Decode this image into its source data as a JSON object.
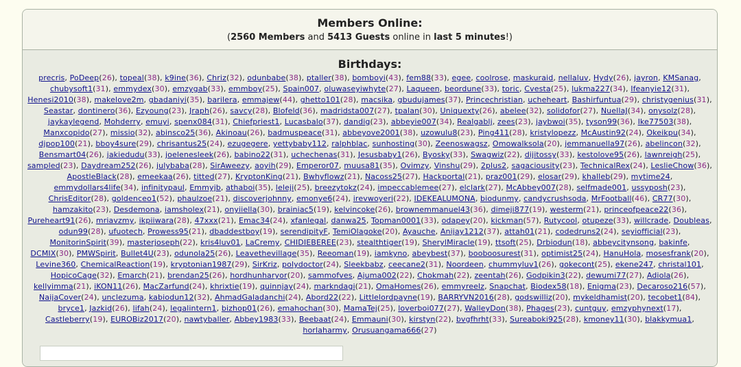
{
  "online": {
    "title": "Members Online:",
    "members_count": "2560 Members",
    "and_word": "and",
    "guests_count": "5413 Guests",
    "online_in": "online in",
    "period": "last 5 minutes",
    "open_paren": "(",
    "close": "!)"
  },
  "birthdays": {
    "title": "Birthdays:",
    "members": [
      [
        "precris",
        null
      ],
      [
        "PoDeep",
        "26"
      ],
      [
        "topeal",
        "38"
      ],
      [
        "k9ine",
        "36"
      ],
      [
        "Chriz",
        "32"
      ],
      [
        "odunbabe",
        "38"
      ],
      [
        "ptaller",
        "38"
      ],
      [
        "bomboyi",
        "43"
      ],
      [
        "fem88",
        "33"
      ],
      [
        "egee",
        null
      ],
      [
        "coolrose",
        null
      ],
      [
        "maskuraid",
        null
      ],
      [
        "nellaluv",
        null
      ],
      [
        "Hydy",
        "26"
      ],
      [
        "jayron",
        null
      ],
      [
        "KMSanag",
        null
      ],
      [
        "chubysoft1",
        "31"
      ],
      [
        "emmydex",
        "30"
      ],
      [
        "emzygab",
        "33"
      ],
      [
        "emmboy",
        "25"
      ],
      [
        "Spain007",
        null
      ],
      [
        "oluwaseyiwhyte",
        "27"
      ],
      [
        "Laqueen",
        null
      ],
      [
        "beordune",
        "33"
      ],
      [
        "toric",
        null
      ],
      [
        "Cvesta",
        "25"
      ],
      [
        "lukma227",
        "34"
      ],
      [
        "Ifeanyie12",
        "31"
      ],
      [
        "Henesi2010",
        "38"
      ],
      [
        "makelove2m",
        null
      ],
      [
        "gbadaniyi",
        "35"
      ],
      [
        "barilera",
        null
      ],
      [
        "emmajew",
        "44"
      ],
      [
        "ghetto101",
        "28"
      ],
      [
        "macsika",
        null
      ],
      [
        "gbudujames",
        "37"
      ],
      [
        "Princechristian",
        null
      ],
      [
        "ucheheart",
        null
      ],
      [
        "Bashirfuntua",
        "29"
      ],
      [
        "christygenius",
        "31"
      ],
      [
        "Seastar",
        null
      ],
      [
        "dontinero",
        "36"
      ],
      [
        "Ezyoung",
        "23"
      ],
      [
        "Jraph",
        "26"
      ],
      [
        "savcy",
        "28"
      ],
      [
        "Blofeld",
        "36"
      ],
      [
        "madridsta007",
        "27"
      ],
      [
        "tpalan",
        "30"
      ],
      [
        "Uniquexty",
        "26"
      ],
      [
        "abelee",
        "32"
      ],
      [
        "solidofor",
        "27"
      ],
      [
        "NuellaJ",
        "34"
      ],
      [
        "onysolz",
        "28"
      ],
      [
        "jaykaylegend",
        null
      ],
      [
        "Mohderry",
        null
      ],
      [
        "emuyi",
        null
      ],
      [
        "spenx084",
        "31"
      ],
      [
        "Chiefpriest1",
        null
      ],
      [
        "Lucasbalo",
        "37"
      ],
      [
        "dandig",
        "23"
      ],
      [
        "abbeyie007",
        "34"
      ],
      [
        "Realgablj",
        null
      ],
      [
        "zees",
        "23"
      ],
      [
        "jaybwoi",
        "35"
      ],
      [
        "tyson99",
        "36"
      ],
      [
        "Ike77503",
        "38"
      ],
      [
        "Manxcopido",
        "27"
      ],
      [
        "missio",
        "32"
      ],
      [
        "abinsco25",
        "36"
      ],
      [
        "Akinoau",
        "26"
      ],
      [
        "badmuspeace",
        "31"
      ],
      [
        "abbeyove2001",
        "38"
      ],
      [
        "uzowulu8",
        "23"
      ],
      [
        "Ping411",
        "28"
      ],
      [
        "kristylopezz",
        null
      ],
      [
        "McAustin92",
        "24"
      ],
      [
        "Okeikpu",
        "34"
      ],
      [
        "djpop100",
        "21"
      ],
      [
        "bboy4sure",
        "29"
      ],
      [
        "chrisantus25",
        "24"
      ],
      [
        "ezugegere",
        null
      ],
      [
        "yettybaby112",
        null
      ],
      [
        "ralphblac",
        null
      ],
      [
        "sunhosting",
        "30"
      ],
      [
        "Zeenoswagsz",
        null
      ],
      [
        "Omowalksola",
        "20"
      ],
      [
        "jemmanuella97",
        "26"
      ],
      [
        "abelincon",
        "32"
      ],
      [
        "Bensmart04",
        "26"
      ],
      [
        "jakiedudu",
        "33"
      ],
      [
        "joelenesleek",
        "26"
      ],
      [
        "babino22",
        "31"
      ],
      [
        "uchechenas",
        "31"
      ],
      [
        "Jesusbaby1",
        "26"
      ],
      [
        "Byosky",
        "33"
      ],
      [
        "Swagwiz",
        "22"
      ],
      [
        "dijitossy",
        "33"
      ],
      [
        "kestolove95",
        "26"
      ],
      [
        "lawnreigh",
        "25"
      ],
      [
        "sampled",
        "23"
      ],
      [
        "Daydream252",
        "26"
      ],
      [
        "julybaba",
        "28"
      ],
      [
        "SirAweezy",
        null
      ],
      [
        "aoyih",
        "29"
      ],
      [
        "Emperor07",
        null
      ],
      [
        "muusa81",
        "35"
      ],
      [
        "Ovimzy",
        null
      ],
      [
        "Vinshu",
        "29"
      ],
      [
        "2plus2",
        null
      ],
      [
        "sagaciousity",
        "23"
      ],
      [
        "TechnicalRex",
        "24"
      ],
      [
        "LeslieChow",
        "36"
      ],
      [
        "ApostleBlack",
        "28"
      ],
      [
        "emeekaa",
        "26"
      ],
      [
        "titted",
        "27"
      ],
      [
        "KryptonKing",
        "21"
      ],
      [
        "Bwhyflowz",
        "21"
      ],
      [
        "Nacoss25",
        "27"
      ],
      [
        "Hackportal",
        "21"
      ],
      [
        "praz001",
        "29"
      ],
      [
        "elosar",
        "29"
      ],
      [
        "khalleb",
        "29"
      ],
      [
        "mytime24",
        null
      ],
      [
        "emmydollars4life",
        "34"
      ],
      [
        "infinitypaul",
        null
      ],
      [
        "Emmyjb",
        null
      ],
      [
        "athaboi",
        "35"
      ],
      [
        "leleji",
        "25"
      ],
      [
        "breezytokz",
        "24"
      ],
      [
        "impeccablemee",
        "27"
      ],
      [
        "elclark",
        "27"
      ],
      [
        "McAbbey007",
        "28"
      ],
      [
        "selfmade001",
        null
      ],
      [
        "ussyposh",
        "23"
      ],
      [
        "ChrisEditor",
        "28"
      ],
      [
        "goldenceo1",
        "52"
      ],
      [
        "phaulzoe",
        "21"
      ],
      [
        "discoverjohnny",
        null
      ],
      [
        "emonye6",
        "24"
      ],
      [
        "irevwoyeri",
        "22"
      ],
      [
        "IDEKEALUMONA",
        null
      ],
      [
        "biodunmy",
        null
      ],
      [
        "candycrushsoda",
        null
      ],
      [
        "MrFootball",
        "46"
      ],
      [
        "CR77",
        "30"
      ],
      [
        "hamzakito",
        "23"
      ],
      [
        "Desdemona",
        null
      ],
      [
        "iamsholex",
        "21"
      ],
      [
        "onyiiella",
        "30"
      ],
      [
        "brainiac5",
        "19"
      ],
      [
        "kelvincoke",
        "26"
      ],
      [
        "brownemmanuel43",
        "36"
      ],
      [
        "dimeji877",
        "19"
      ],
      [
        "westerm",
        "21"
      ],
      [
        "princeofpeace22",
        "36"
      ],
      [
        "Pureheart91",
        "26"
      ],
      [
        "mriavzmy",
        null
      ],
      [
        "ikpiiwara",
        "28"
      ],
      [
        "47xxx",
        "21"
      ],
      [
        "Emac34",
        "24"
      ],
      [
        "xfanlegal",
        null
      ],
      [
        "danwa25",
        null
      ],
      [
        "Topman0001",
        "33"
      ],
      [
        "odapey",
        "20"
      ],
      [
        "kickman",
        "57"
      ],
      [
        "Rutycool",
        null
      ],
      [
        "otupeze",
        "33"
      ],
      [
        "willcrade",
        null
      ],
      [
        "Doubleas",
        null
      ],
      [
        "odun99",
        "28"
      ],
      [
        "ufuotech",
        null
      ],
      [
        "Prowess95",
        "21"
      ],
      [
        "dbaddestboy",
        "19"
      ],
      [
        "serendipityF",
        null
      ],
      [
        "TemiOlagoke",
        "20"
      ],
      [
        "Ayauche",
        null
      ],
      [
        "Anijay1212",
        "37"
      ],
      [
        "attah01",
        "21"
      ],
      [
        "codedruns2",
        "24"
      ],
      [
        "seyiofficial",
        "23"
      ],
      [
        "MonitorinSpirit",
        "39"
      ],
      [
        "masterjoseph",
        "22"
      ],
      [
        "kris4luv01",
        null
      ],
      [
        "LaCremy",
        null
      ],
      [
        "CHIDIEBEREE",
        "23"
      ],
      [
        "stealthtiger",
        "19"
      ],
      [
        "SherylMiracle",
        "19"
      ],
      [
        "ttsoft",
        "25"
      ],
      [
        "Drbiodun",
        "18"
      ],
      [
        "abbeycitynsong",
        null
      ],
      [
        "bakinfe",
        null
      ],
      [
        "DCMIX",
        "30"
      ],
      [
        "PMWSpirit",
        null
      ],
      [
        "Bullet4U",
        "23"
      ],
      [
        "odunola25",
        "26"
      ],
      [
        "Leavethevillage",
        "35"
      ],
      [
        "Reeoman",
        "19"
      ],
      [
        "iamkyno",
        null
      ],
      [
        "abeybest",
        "37"
      ],
      [
        "booboosurest",
        "31"
      ],
      [
        "optimist25",
        "24"
      ],
      [
        "HanuHola",
        null
      ],
      [
        "mosesfrank",
        "20"
      ],
      [
        "Levine360",
        null
      ],
      [
        "ChemicalReaction",
        "19"
      ],
      [
        "kryptonian1987",
        "29"
      ],
      [
        "SirKriz",
        null
      ],
      [
        "polydoctor",
        "24"
      ],
      [
        "Sleekbabz",
        null
      ],
      [
        "ceecane2",
        "31"
      ],
      [
        "Noordeen",
        null
      ],
      [
        "chummyluv1",
        "26"
      ],
      [
        "gokecont",
        "25"
      ],
      [
        "ekene247",
        null
      ],
      [
        "christal101",
        null
      ],
      [
        "HopicoCage",
        "32"
      ],
      [
        "Emarch",
        "21"
      ],
      [
        "brendan25",
        "26"
      ],
      [
        "hordhunharyor",
        "20"
      ],
      [
        "sammofves",
        null
      ],
      [
        "Ajuma002",
        "22"
      ],
      [
        "Chokmah",
        "22"
      ],
      [
        "zeentah",
        "26"
      ],
      [
        "Godpikin3",
        "22"
      ],
      [
        "dewumi77",
        "27"
      ],
      [
        "Adiola",
        "26"
      ],
      [
        "kellyimma",
        "21"
      ],
      [
        "iKON11",
        "26"
      ],
      [
        "MacZarfund",
        "24"
      ],
      [
        "khrixtie",
        "19"
      ],
      [
        "quinnjay",
        "24"
      ],
      [
        "markndagi",
        "21"
      ],
      [
        "OmaHomes",
        "26"
      ],
      [
        "emmyreelz",
        null
      ],
      [
        "Snapchat",
        null
      ],
      [
        "Biodex58",
        "18"
      ],
      [
        "Enigma",
        "23"
      ],
      [
        "Decaroso216",
        "57"
      ],
      [
        "NaijaCover",
        "24"
      ],
      [
        "unclezuma",
        null
      ],
      [
        "kabiodun12",
        "32"
      ],
      [
        "AhmadGaladanchi",
        "24"
      ],
      [
        "Abord22",
        "22"
      ],
      [
        "Littlelordpayne",
        "19"
      ],
      [
        "BARRYVN2016",
        "28"
      ],
      [
        "godswilliz",
        "20"
      ],
      [
        "mykeldhamist",
        "20"
      ],
      [
        "tecobet1",
        "84"
      ],
      [
        "bryce1",
        null
      ],
      [
        "Jazkid",
        "26"
      ],
      [
        "lifah",
        "24"
      ],
      [
        "legalintern1",
        null
      ],
      [
        "bizhop01",
        "26"
      ],
      [
        "emahochan",
        "30"
      ],
      [
        "MamaTej",
        "25"
      ],
      [
        "loverboi077",
        "27"
      ],
      [
        "WalleyDon",
        "38"
      ],
      [
        "Phages",
        "23"
      ],
      [
        "cuntguy",
        null
      ],
      [
        "emzyphynext",
        "17"
      ],
      [
        "Castleberry",
        "19"
      ],
      [
        "EUROBiz2017",
        "20"
      ],
      [
        "nawtyballer",
        null
      ],
      [
        "Abbey1983",
        "33"
      ],
      [
        "Beebaat",
        "24"
      ],
      [
        "Emmauni",
        "30"
      ],
      [
        "kirstyn",
        "22"
      ],
      [
        "bvgfhrht",
        "33"
      ],
      [
        "Sureaboki925",
        "28"
      ],
      [
        "kmoney11",
        "30"
      ],
      [
        "blakkymua1",
        null
      ],
      [
        "horlaharmy",
        null
      ],
      [
        "Orusuangama666",
        "27"
      ]
    ]
  }
}
